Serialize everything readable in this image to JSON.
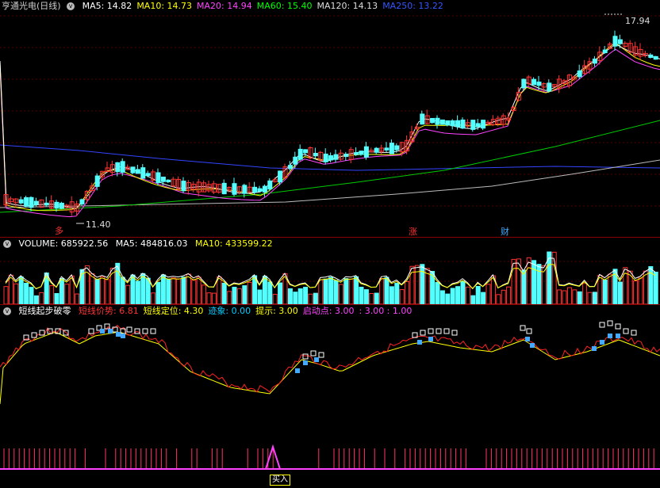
{
  "price_panel": {
    "stock": "亨通光电",
    "period": "(日线)",
    "ma": [
      {
        "label": "MA5: 14.82",
        "color": "#ffffff"
      },
      {
        "label": "MA10: 14.73",
        "color": "#ffff00"
      },
      {
        "label": "MA20: 14.94",
        "color": "#ff44ff"
      },
      {
        "label": "MA60: 15.40",
        "color": "#00ff00"
      },
      {
        "label": "MA120: 14.13",
        "color": "#dddddd"
      },
      {
        "label": "MA250: 13.22",
        "color": "#3355ff"
      }
    ],
    "high_label": "17.94",
    "low_label": "11.40",
    "markers": [
      {
        "text": "多",
        "color": "#ff3333"
      },
      {
        "text": "涨",
        "color": "#ff3333"
      },
      {
        "text": "财",
        "color": "#44aaff"
      }
    ]
  },
  "volume_panel": {
    "title": "VOLUME: 685922.56",
    "ma5": "MA5: 484816.03",
    "ma10": "MA10: 433599.22"
  },
  "indicator_panel": {
    "name": "短线起步破零",
    "items": [
      {
        "label": "短线价势: 6.81",
        "color": "#ff3333"
      },
      {
        "label": "短线定位: 4.30",
        "color": "#ffff00"
      },
      {
        "label": "迹象: 0.00",
        "color": "#00ccff"
      },
      {
        "label": "提示: 3.00",
        "color": "#ffff00"
      },
      {
        "label": "启动点: 3.00",
        "color": "#ff44ff"
      },
      {
        "label": ": 3.00 : 1.00",
        "color": "#ff44ff"
      }
    ]
  },
  "signal_panel": {
    "buy_label": "买入"
  },
  "colors": {
    "up": "#ff3333",
    "down": "#54ffff",
    "border": "#8b0000"
  }
}
